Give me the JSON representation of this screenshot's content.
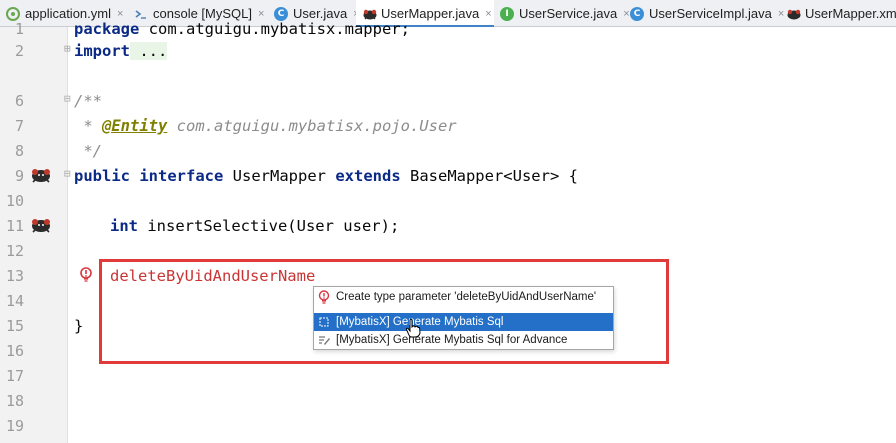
{
  "tabs": [
    {
      "label": "application.yml",
      "icon": "yml-icon",
      "active": false
    },
    {
      "label": "console [MySQL]",
      "icon": "console-icon",
      "active": false
    },
    {
      "label": "User.java",
      "icon": "class-icon",
      "active": false
    },
    {
      "label": "UserMapper.java",
      "icon": "mapper-icon",
      "active": true
    },
    {
      "label": "UserService.java",
      "icon": "interface-icon",
      "active": false
    },
    {
      "label": "UserServiceImpl.java",
      "icon": "class-icon",
      "active": false
    },
    {
      "label": "UserMapper.xml",
      "icon": "mapper-icon",
      "active": false
    }
  ],
  "tab_close_glyph": "×",
  "line_numbers": [
    "1",
    "2",
    "6",
    "7",
    "8",
    "9",
    "10",
    "11",
    "12",
    "13",
    "14",
    "15",
    "16",
    "17",
    "18",
    "19"
  ],
  "code": {
    "l1_kw": "package",
    "l1_rest": " com.atguigu.mybatisx.mapper;",
    "l2_kw": "import",
    "l2_rest": " ...",
    "l6": "/**",
    "l7_star": " * ",
    "l7_ann": "@Entity",
    "l7_rest": " com.atguigu.mybatisx.pojo.User",
    "l8": " */",
    "l9_kw1": "public",
    "l9_kw2": "interface",
    "l9_name": " UserMapper ",
    "l9_kw3": "extends",
    "l9_rest": " BaseMapper<User> {",
    "l11_kw": "int",
    "l11_rest": " insertSelective(User user);",
    "l13_err": "deleteByUidAndUserName",
    "l15": "}"
  },
  "popup": {
    "items": [
      {
        "label": "Create type parameter 'deleteByUidAndUserName'",
        "icon": "error-bulb-icon",
        "selected": false
      },
      {
        "label": "[MybatisX] Generate Mybatis Sql",
        "icon": "mybatisx-icon",
        "selected": true
      },
      {
        "label": "[MybatisX] Generate Mybatis Sql for Advance",
        "icon": "edit-icon",
        "selected": false
      }
    ]
  },
  "colors": {
    "highlight_border": "#e03a3a",
    "selection": "#2470c8",
    "keyword": "#0b2a86",
    "error_text": "#c93535"
  }
}
